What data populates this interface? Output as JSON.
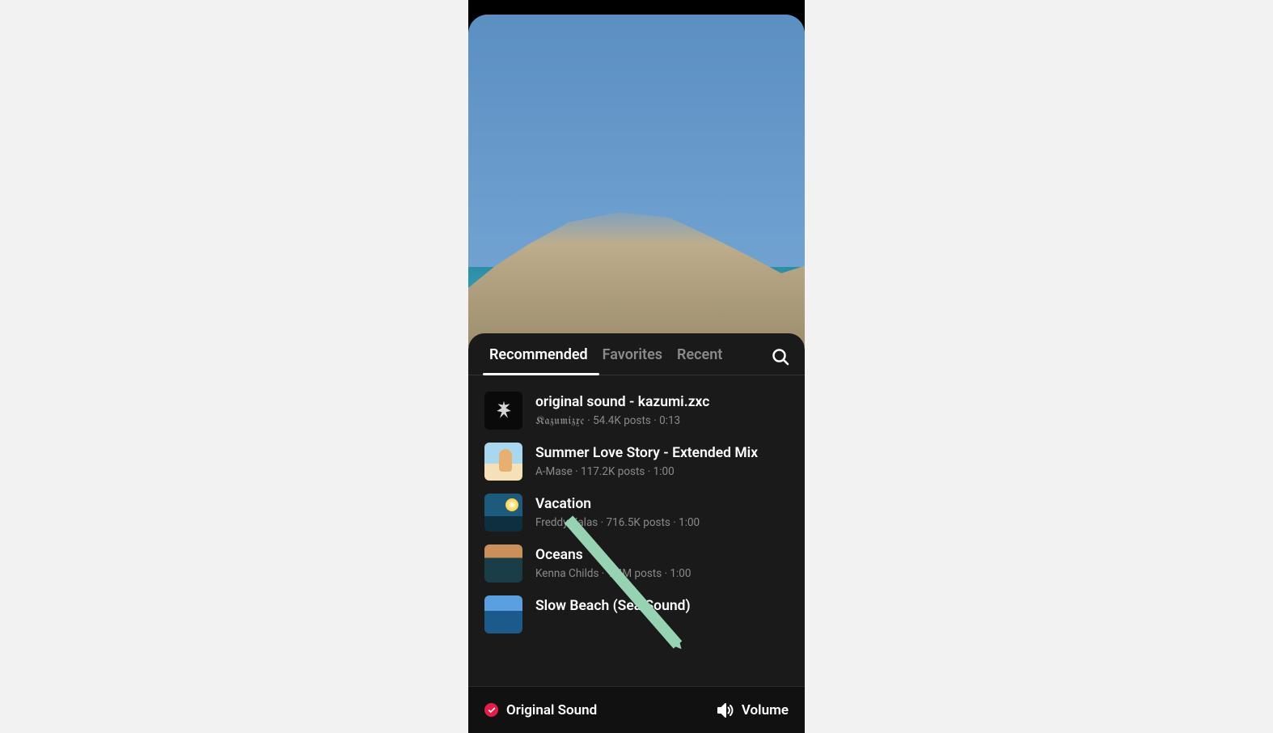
{
  "tabs": {
    "recommended": "Recommended",
    "favorites": "Favorites",
    "recent": "Recent"
  },
  "sounds": [
    {
      "title": "original sound - kazumi.zxc",
      "artist": "Kazumizxc",
      "posts": "54.4K posts",
      "duration": "0:13",
      "artist_fancy": true
    },
    {
      "title": "Summer Love Story - Extended Mix",
      "artist": "A-Mase",
      "posts": "117.2K posts",
      "duration": "1:00"
    },
    {
      "title": "Vacation",
      "artist": "Freddy Kalas",
      "posts": "716.5K posts",
      "duration": "1:00"
    },
    {
      "title": "Oceans",
      "artist": "Kenna Childs",
      "posts": "1.4M posts",
      "duration": "1:00"
    },
    {
      "title": "Slow Beach (Sea Sound)",
      "artist": "",
      "posts": "",
      "duration": ""
    }
  ],
  "bottom": {
    "original_sound": "Original Sound",
    "volume": "Volume"
  }
}
